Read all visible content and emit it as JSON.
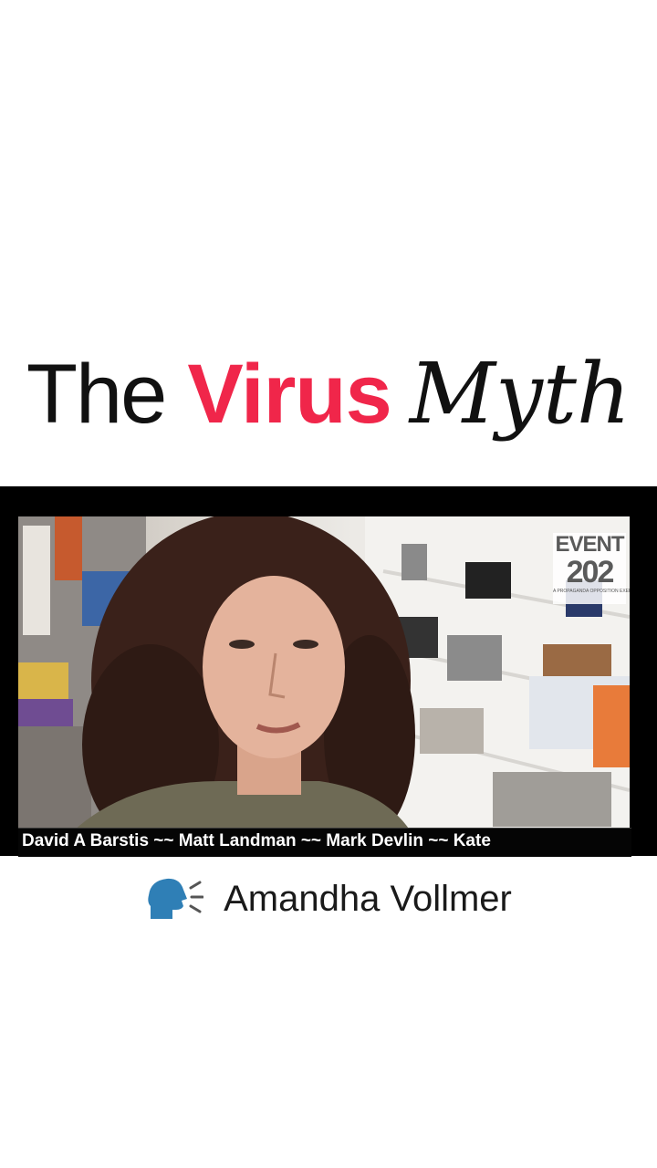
{
  "headline": {
    "word1": "The",
    "word2": "Virus",
    "word3": "Myth"
  },
  "colors": {
    "accent": "#f0264a",
    "text": "#111111",
    "frame": "#000000"
  },
  "video": {
    "logo": {
      "line1": "EVENT",
      "line2": "202",
      "line3": "A PROPAGANDA OPPOSITION EXERCISE"
    },
    "ticker": "David A Barstis ~~ Matt Landman ~~ Mark Devlin ~~ Kate"
  },
  "speaker": {
    "icon": "speaking-head-icon",
    "name": "Amandha Vollmer"
  }
}
